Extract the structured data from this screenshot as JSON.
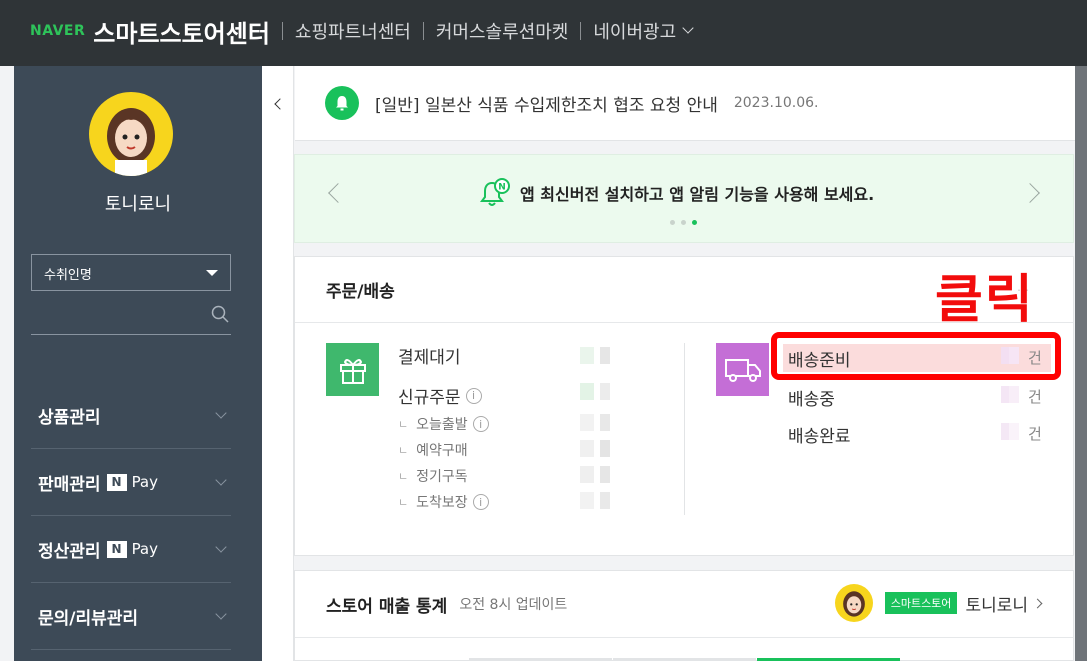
{
  "header": {
    "naver_logo": "NAVER",
    "title": "스마트스토어센터",
    "nav": [
      "쇼핑파트너센터",
      "커머스솔루션마켓",
      "네이버광고"
    ]
  },
  "sidebar": {
    "username": "토니로니",
    "select_value": "수취인명",
    "menu": [
      {
        "label": "상품관리",
        "npay": false
      },
      {
        "label": "판매관리",
        "npay": true
      },
      {
        "label": "정산관리",
        "npay": true
      },
      {
        "label": "문의/리뷰관리",
        "npay": false
      }
    ],
    "npay_n": "N",
    "npay_pay": "Pay"
  },
  "notice": {
    "text": "[일반] 일본산 식품 수입제한조치 협조 요청 안내",
    "date": "2023.10.06."
  },
  "banner": {
    "message": "앱 최신버전 설치하고 앱 알림 기능을 사용해 보세요.",
    "dots": 3,
    "active_dot": 3
  },
  "orders": {
    "title": "주문/배송",
    "left_rows": [
      {
        "label": "결제대기",
        "info": false
      },
      {
        "label": "신규주문",
        "info": true
      }
    ],
    "sub_rows": [
      {
        "label": "오늘출발",
        "info": true
      },
      {
        "label": "예약구매",
        "info": false
      },
      {
        "label": "정기구독",
        "info": false
      },
      {
        "label": "도착보장",
        "info": true
      }
    ],
    "shipping_rows": [
      "배송준비",
      "배송중",
      "배송완료"
    ],
    "unit": "건"
  },
  "annotation": {
    "click_text": "클릭"
  },
  "sales": {
    "title": "스토어 매출 통계",
    "subtitle": "오전 8시 업데이트",
    "badge": "스마트스토어",
    "store_name": "토니로니"
  },
  "colors": {
    "accent_green": "#19c15b",
    "highlight_red": "#ff0000",
    "sidebar_bg": "#3d4a57"
  }
}
